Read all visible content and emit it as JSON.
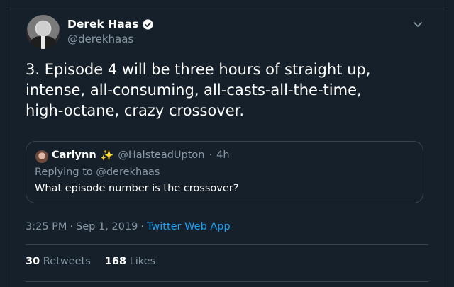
{
  "author": {
    "name": "Derek Haas",
    "handle": "@derekhaas"
  },
  "tweet": {
    "text": "3.  Episode 4 will be three hours of straight up,\nintense, all-consuming, all-casts-all-the-time,\nhigh-octane, crazy crossover."
  },
  "quoted": {
    "name": "Carlynn",
    "emoji": "✨",
    "handle": "@HalsteadUpton",
    "separator": "·",
    "time": "4h",
    "replying_to": "Replying to @derekhaas",
    "text": "What episode number is the crossover?"
  },
  "meta": {
    "time": "3:25 PM",
    "date": "Sep 1, 2019",
    "separator": "·",
    "app": "Twitter Web App"
  },
  "stats": {
    "retweets_count": "30",
    "retweets_label": "Retweets",
    "likes_count": "168",
    "likes_label": "Likes"
  },
  "colors": {
    "background": "#15202b",
    "border": "#38444d",
    "secondary_text": "#8899a6",
    "link": "#1da1f2",
    "verified": "#ffffff"
  },
  "icons": {
    "verified": "verified-badge-icon",
    "caret": "chevron-down-icon"
  }
}
